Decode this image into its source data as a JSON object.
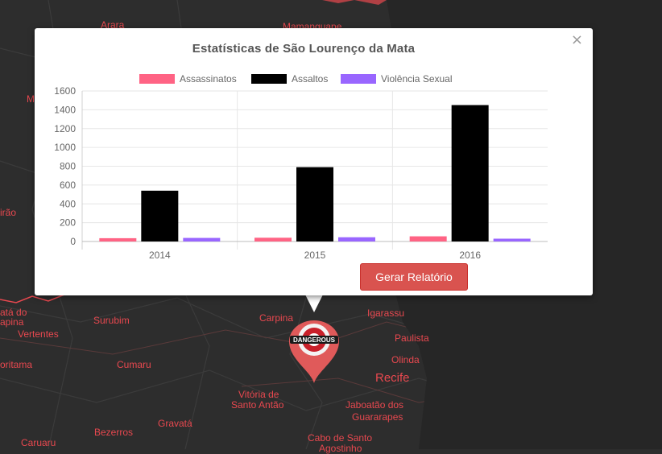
{
  "map": {
    "labels": [
      {
        "id": "arara",
        "text": "Arara"
      },
      {
        "id": "mamanguape",
        "text": "Mamanguape"
      },
      {
        "id": "m-partial",
        "text": "M"
      },
      {
        "id": "irao",
        "text": "irão"
      },
      {
        "id": "ata",
        "text": "atá do"
      },
      {
        "id": "apina",
        "text": "apina"
      },
      {
        "id": "vertentes",
        "text": "Vertentes"
      },
      {
        "id": "surubim",
        "text": "Surubim"
      },
      {
        "id": "carpina",
        "text": "Carpina"
      },
      {
        "id": "igarassu",
        "text": "Igarassu"
      },
      {
        "id": "paulista",
        "text": "Paulista"
      },
      {
        "id": "olinda",
        "text": "Olinda"
      },
      {
        "id": "recife",
        "text": "Recife"
      },
      {
        "id": "toritama",
        "text": "oritama"
      },
      {
        "id": "cumaru",
        "text": "Cumaru"
      },
      {
        "id": "vitoria1",
        "text": "Vitória de"
      },
      {
        "id": "vitoria2",
        "text": "Santo Antão"
      },
      {
        "id": "jaboatao1",
        "text": "Jaboatão dos"
      },
      {
        "id": "jaboatao2",
        "text": "Guararapes"
      },
      {
        "id": "bezerros",
        "text": "Bezerros"
      },
      {
        "id": "gravata",
        "text": "Gravatá"
      },
      {
        "id": "caruaru",
        "text": "Caruaru"
      },
      {
        "id": "cabo1",
        "text": "Cabo de Santo"
      },
      {
        "id": "cabo2",
        "text": "Agostinho"
      }
    ]
  },
  "popup": {
    "close_label": "×",
    "report_button": "Gerar Relatório"
  },
  "marker": {
    "badge_text": "DANGEROUS",
    "icon": "danger-pin-icon"
  },
  "chart_data": {
    "type": "bar",
    "title": "Estatísticas de São Lourenço da Mata",
    "categories": [
      "2014",
      "2015",
      "2016"
    ],
    "series": [
      {
        "name": "Assassinatos",
        "color": "#ff6384",
        "values": [
          35,
          40,
          55
        ]
      },
      {
        "name": "Assaltos",
        "color": "#000000",
        "values": [
          540,
          790,
          1450
        ]
      },
      {
        "name": "Violência Sexual",
        "color": "#9966ff",
        "values": [
          38,
          45,
          30
        ]
      }
    ],
    "ylim": [
      0,
      1600
    ],
    "yticks": [
      "0",
      "200",
      "400",
      "600",
      "800",
      "1000",
      "1200",
      "1400",
      "1600"
    ],
    "grid": true,
    "legend": "top"
  }
}
